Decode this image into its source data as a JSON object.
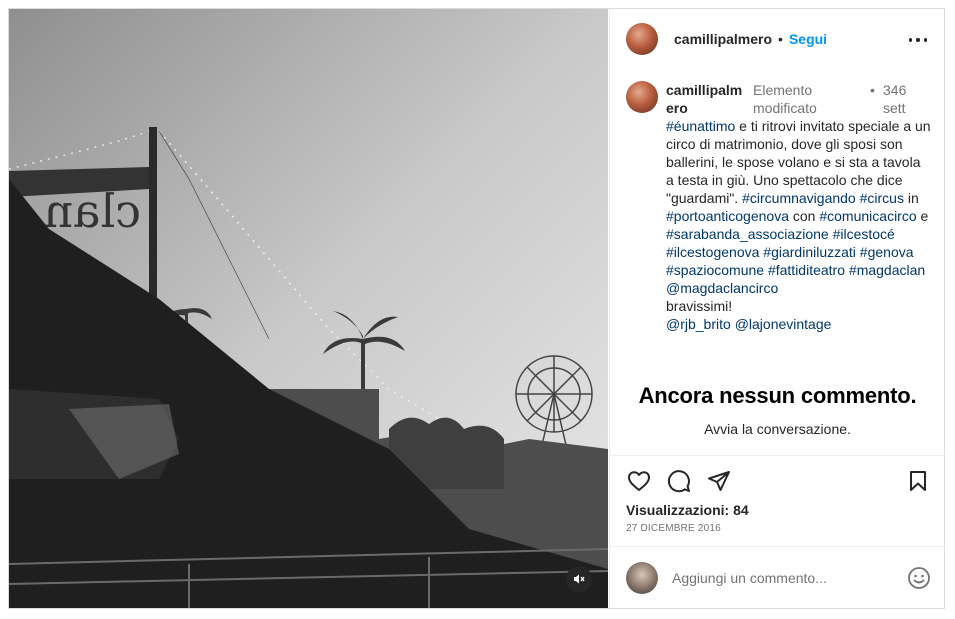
{
  "post": {
    "username": "camillipalmero",
    "dot": "•",
    "follow_label": "Segui"
  },
  "caption": {
    "username": "camillipalmero",
    "edited": "Elemento modificato",
    "separator": "•",
    "time": "346 sett",
    "segments": [
      {
        "text": "#éunattimo",
        "tag": true
      },
      {
        "text": " e ti ritrovi invitato speciale a un circo di matrimonio, dove gli sposi son ballerini, le spose volano e si sta a tavola a testa in giù. Uno spettacolo che dice \"guardami\". ",
        "tag": false
      },
      {
        "text": "#circumnavigando",
        "tag": true
      },
      {
        "text": " ",
        "tag": false
      },
      {
        "text": "#circus",
        "tag": true
      },
      {
        "text": " in ",
        "tag": false
      },
      {
        "text": "#portoanticogenova",
        "tag": true
      },
      {
        "text": " con ",
        "tag": false
      },
      {
        "text": "#comunicacirco",
        "tag": true
      },
      {
        "text": " e ",
        "tag": false
      },
      {
        "text": "#sarabanda_associazione",
        "tag": true
      },
      {
        "text": " ",
        "tag": false
      },
      {
        "text": "#ilcestocé",
        "tag": true
      },
      {
        "text": " ",
        "tag": false
      },
      {
        "text": "#ilcestogenova",
        "tag": true
      },
      {
        "text": " ",
        "tag": false
      },
      {
        "text": "#giardiniluzzati",
        "tag": true
      },
      {
        "text": " ",
        "tag": false
      },
      {
        "text": "#genova",
        "tag": true
      },
      {
        "text": " ",
        "tag": false
      },
      {
        "text": "#spaziocomune",
        "tag": true
      },
      {
        "text": " ",
        "tag": false
      },
      {
        "text": "#fattiditeatro",
        "tag": true
      },
      {
        "text": " ",
        "tag": false
      },
      {
        "text": "#magdaclan",
        "tag": true
      },
      {
        "text": " ",
        "tag": false
      },
      {
        "text": "@magdaclancirco",
        "tag": true
      },
      {
        "text": "\nbravissimi!\n",
        "tag": false
      },
      {
        "text": "@rjb_brito",
        "tag": true
      },
      {
        "text": " ",
        "tag": false
      },
      {
        "text": "@lajonevintage",
        "tag": true
      }
    ]
  },
  "comments": {
    "empty_title": "Ancora nessun commento.",
    "empty_subtitle": "Avvia la conversazione."
  },
  "stats": {
    "views": "Visualizzazioni: 84",
    "date": "27 DICEMBRE 2016"
  },
  "composer": {
    "placeholder": "Aggiungi un commento..."
  },
  "media": {
    "sign_text": "clan",
    "mute_icon": "speaker-muted-icon"
  },
  "icons": {
    "like": "heart-icon",
    "comment": "comment-bubble-icon",
    "share": "paper-plane-icon",
    "save": "bookmark-icon",
    "more": "ellipsis-icon",
    "emoji": "smiley-icon"
  },
  "colors": {
    "link": "#0095f6",
    "hashtag": "#00376b",
    "muted_text": "#737373",
    "border": "#dbdbdb"
  }
}
